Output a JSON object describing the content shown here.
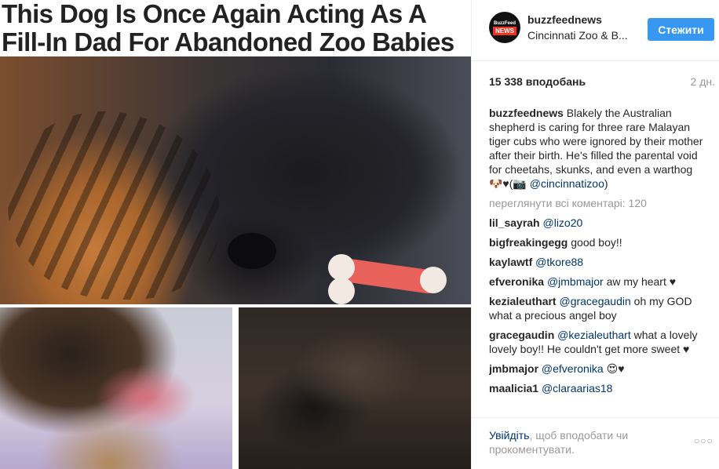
{
  "post": {
    "headline_line1": "This Dog Is Once Again Acting As A",
    "headline_line2": "Fill-In Dad For Abandoned Zoo Babies"
  },
  "header": {
    "avatar_top": "BuzzFeed",
    "avatar_bottom": "NEWS",
    "username": "buzzfeednews",
    "location": "Cincinnati Zoo & B...",
    "follow_label": "Стежити"
  },
  "meta": {
    "likes": "15 338 вподобань",
    "time": "2 дн."
  },
  "caption": {
    "author": "buzzfeednews",
    "text": "Blakely the Australian shepherd is caring for three rare Malayan tiger cubs who were ignored by their mother after their birth. He's filled the parental void for cheetahs, skunks, and even a warthog 🐶♥(📷 ",
    "mention": "@cincinnatizoo",
    "closing": ")"
  },
  "view_all": "переглянути всі коментарі: 120",
  "comments": [
    {
      "user": "lil_sayrah",
      "mention": "@lizo20",
      "text": ""
    },
    {
      "user": "bigfreakingegg",
      "mention": "",
      "text": "good boy!!"
    },
    {
      "user": "kaylawtf",
      "mention": "@tkore88",
      "text": ""
    },
    {
      "user": "efveronika",
      "mention": "@jmbmajor",
      "text": "aw my heart ♥"
    },
    {
      "user": "kezialeuthart",
      "mention": "@gracegaudin",
      "text": "oh my GOD what a precious angel boy"
    },
    {
      "user": "gracegaudin",
      "mention": "@kezialeuthart",
      "text": "what a lovely lovely boy!! He couldn't get more sweet ♥"
    },
    {
      "user": "jmbmajor",
      "mention": "@efveronika",
      "text": "😍♥"
    },
    {
      "user": "maalicia1",
      "mention": "@claraarias18",
      "text": ""
    }
  ],
  "footer": {
    "login_link": "Увійдіть",
    "prompt": ", щоб вподобати чи прокоментувати.",
    "more": "○○○"
  }
}
